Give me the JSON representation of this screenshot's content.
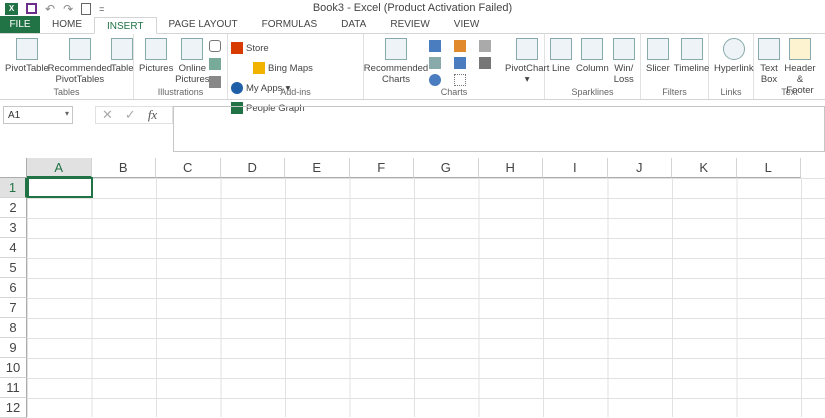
{
  "title": "Book3 - Excel (Product Activation Failed)",
  "qat": {
    "app_icon": "X",
    "save": "save-icon",
    "undo": "↶",
    "redo": "↷",
    "preview": "print-preview-icon",
    "customize": "="
  },
  "tabs": [
    "FILE",
    "HOME",
    "INSERT",
    "PAGE LAYOUT",
    "FORMULAS",
    "DATA",
    "REVIEW",
    "VIEW"
  ],
  "active_tab": "INSERT",
  "groups": {
    "tables": {
      "label": "Tables",
      "pivottable": "PivotTable",
      "recommended_pivot": "Recommended PivotTables",
      "table": "Table"
    },
    "illustrations": {
      "label": "Illustrations",
      "pictures": "Pictures",
      "online_pictures": "Online Pictures"
    },
    "addins": {
      "label": "Add-ins",
      "store": "Store",
      "my_apps": "My Apps",
      "bing_maps": "Bing Maps",
      "people_graph": "People Graph"
    },
    "charts": {
      "label": "Charts",
      "recommended": "Recommended Charts",
      "pivotchart": "PivotChart"
    },
    "sparklines": {
      "label": "Sparklines",
      "line": "Line",
      "column": "Column",
      "winloss": "Win/ Loss"
    },
    "filters": {
      "label": "Filters",
      "slicer": "Slicer",
      "timeline": "Timeline"
    },
    "links": {
      "label": "Links",
      "hyperlink": "Hyperlink"
    },
    "text": {
      "label": "Text",
      "textbox": "Text Box",
      "header_footer": "Header & Footer"
    }
  },
  "formula_bar": {
    "name_box": "A1",
    "cancel": "✕",
    "enter": "✓",
    "fx": "fx",
    "value": ""
  },
  "columns": [
    "A",
    "B",
    "C",
    "D",
    "E",
    "F",
    "G",
    "H",
    "I",
    "J",
    "K",
    "L"
  ],
  "rows": [
    "1",
    "2",
    "3",
    "4",
    "5",
    "6",
    "7",
    "8",
    "9",
    "10",
    "11",
    "12"
  ],
  "colors": {
    "accent": "#217346"
  }
}
